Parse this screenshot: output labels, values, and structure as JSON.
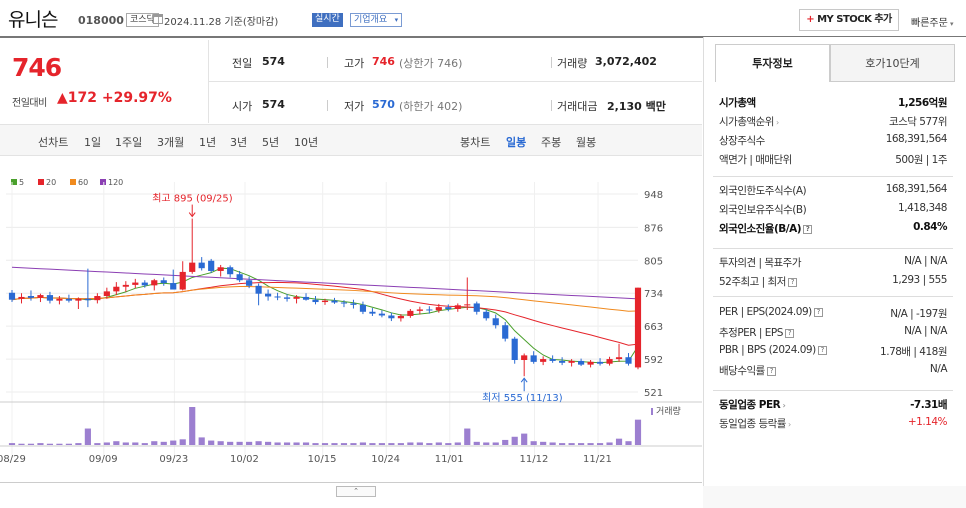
{
  "header": {
    "name": "유니슨",
    "code": "018000",
    "market": "코스닥",
    "date": "2024.11.28 기준(장마감)",
    "realtime": "실시간",
    "company_info": "기업개요",
    "mystock_plus": "+",
    "mystock": "MY STOCK 추가",
    "quick_order": "빠른주문"
  },
  "quote": {
    "price": "746",
    "change_label": "전일대비",
    "change": "172",
    "change_pct": "+29.97%",
    "prev_close_label": "전일",
    "prev_close": "574",
    "open_label": "시가",
    "open": "574",
    "high_label": "고가",
    "high": "746",
    "upper_limit": "(상한가 746)",
    "low_label": "저가",
    "low": "570",
    "lower_limit": "(하한가 402)",
    "volume_label": "거래량",
    "volume": "3,072,402",
    "amount_label": "거래대금",
    "amount": "2,130 백만"
  },
  "periods": {
    "line_label": "선차트",
    "line_items": [
      "1일",
      "1주일",
      "3개월",
      "1년",
      "3년",
      "5년",
      "10년"
    ],
    "candle_label": "봉차트",
    "candle_items": [
      "일봉",
      "주봉",
      "월봉"
    ],
    "candle_active": "일봉"
  },
  "legend": [
    "5",
    "20",
    "60",
    "120"
  ],
  "legend_colors": [
    "#4aa02c",
    "#e5242b",
    "#f08a1e",
    "#8b3fb3"
  ],
  "chart_data": {
    "type": "candlestick",
    "y_ticks": [
      "948",
      "876",
      "805",
      "734",
      "663",
      "592",
      "521"
    ],
    "ylim": [
      521,
      948
    ],
    "x_ticks": [
      "08/29",
      "09/09",
      "09/23",
      "10/02",
      "10/15",
      "10/24",
      "11/01",
      "11/12",
      "11/21"
    ],
    "annotations": {
      "high": "최고 895 (09/25)",
      "low": "최저 555 (11/13)"
    },
    "volume_label": "거래량",
    "up_color": "#e5242b",
    "down_color": "#2a6ad3",
    "candles": [
      {
        "o": 735,
        "h": 741,
        "l": 715,
        "c": 720
      },
      {
        "o": 722,
        "h": 734,
        "l": 712,
        "c": 726
      },
      {
        "o": 728,
        "h": 740,
        "l": 718,
        "c": 724
      },
      {
        "o": 724,
        "h": 733,
        "l": 715,
        "c": 730
      },
      {
        "o": 730,
        "h": 737,
        "l": 712,
        "c": 718
      },
      {
        "o": 718,
        "h": 728,
        "l": 710,
        "c": 722
      },
      {
        "o": 722,
        "h": 731,
        "l": 714,
        "c": 718
      },
      {
        "o": 718,
        "h": 725,
        "l": 700,
        "c": 722
      },
      {
        "o": 722,
        "h": 787,
        "l": 704,
        "c": 719
      },
      {
        "o": 719,
        "h": 734,
        "l": 712,
        "c": 728
      },
      {
        "o": 728,
        "h": 746,
        "l": 722,
        "c": 738
      },
      {
        "o": 738,
        "h": 758,
        "l": 730,
        "c": 748
      },
      {
        "o": 748,
        "h": 760,
        "l": 737,
        "c": 752
      },
      {
        "o": 752,
        "h": 765,
        "l": 745,
        "c": 757
      },
      {
        "o": 757,
        "h": 762,
        "l": 746,
        "c": 751
      },
      {
        "o": 751,
        "h": 765,
        "l": 740,
        "c": 762
      },
      {
        "o": 762,
        "h": 768,
        "l": 750,
        "c": 756
      },
      {
        "o": 756,
        "h": 785,
        "l": 742,
        "c": 742
      },
      {
        "o": 742,
        "h": 803,
        "l": 740,
        "c": 780
      },
      {
        "o": 780,
        "h": 895,
        "l": 776,
        "c": 800
      },
      {
        "o": 800,
        "h": 812,
        "l": 783,
        "c": 788
      },
      {
        "o": 804,
        "h": 808,
        "l": 778,
        "c": 782
      },
      {
        "o": 782,
        "h": 795,
        "l": 770,
        "c": 790
      },
      {
        "o": 790,
        "h": 794,
        "l": 768,
        "c": 775
      },
      {
        "o": 775,
        "h": 782,
        "l": 758,
        "c": 762
      },
      {
        "o": 762,
        "h": 770,
        "l": 745,
        "c": 750
      },
      {
        "o": 750,
        "h": 755,
        "l": 708,
        "c": 733
      },
      {
        "o": 733,
        "h": 742,
        "l": 718,
        "c": 727
      },
      {
        "o": 727,
        "h": 735,
        "l": 719,
        "c": 725
      },
      {
        "o": 725,
        "h": 732,
        "l": 716,
        "c": 722
      },
      {
        "o": 722,
        "h": 730,
        "l": 712,
        "c": 726
      },
      {
        "o": 726,
        "h": 734,
        "l": 718,
        "c": 720
      },
      {
        "o": 720,
        "h": 728,
        "l": 710,
        "c": 715
      },
      {
        "o": 715,
        "h": 722,
        "l": 709,
        "c": 718
      },
      {
        "o": 718,
        "h": 724,
        "l": 711,
        "c": 714
      },
      {
        "o": 714,
        "h": 719,
        "l": 704,
        "c": 712
      },
      {
        "o": 712,
        "h": 720,
        "l": 701,
        "c": 709
      },
      {
        "o": 709,
        "h": 716,
        "l": 689,
        "c": 694
      },
      {
        "o": 694,
        "h": 702,
        "l": 685,
        "c": 690
      },
      {
        "o": 690,
        "h": 697,
        "l": 682,
        "c": 686
      },
      {
        "o": 686,
        "h": 692,
        "l": 674,
        "c": 680
      },
      {
        "o": 680,
        "h": 689,
        "l": 673,
        "c": 685
      },
      {
        "o": 685,
        "h": 700,
        "l": 681,
        "c": 696
      },
      {
        "o": 696,
        "h": 705,
        "l": 688,
        "c": 699
      },
      {
        "o": 699,
        "h": 706,
        "l": 690,
        "c": 697
      },
      {
        "o": 697,
        "h": 711,
        "l": 692,
        "c": 704
      },
      {
        "o": 704,
        "h": 710,
        "l": 695,
        "c": 700
      },
      {
        "o": 700,
        "h": 712,
        "l": 694,
        "c": 708
      },
      {
        "o": 708,
        "h": 768,
        "l": 698,
        "c": 710
      },
      {
        "o": 712,
        "h": 716,
        "l": 688,
        "c": 694
      },
      {
        "o": 694,
        "h": 700,
        "l": 675,
        "c": 680
      },
      {
        "o": 680,
        "h": 688,
        "l": 658,
        "c": 665
      },
      {
        "o": 665,
        "h": 672,
        "l": 630,
        "c": 636
      },
      {
        "o": 636,
        "h": 640,
        "l": 582,
        "c": 590
      },
      {
        "o": 590,
        "h": 604,
        "l": 555,
        "c": 600
      },
      {
        "o": 600,
        "h": 609,
        "l": 582,
        "c": 586
      },
      {
        "o": 586,
        "h": 598,
        "l": 579,
        "c": 592
      },
      {
        "o": 592,
        "h": 600,
        "l": 584,
        "c": 588
      },
      {
        "o": 588,
        "h": 596,
        "l": 579,
        "c": 584
      },
      {
        "o": 584,
        "h": 592,
        "l": 576,
        "c": 588
      },
      {
        "o": 588,
        "h": 593,
        "l": 577,
        "c": 580
      },
      {
        "o": 580,
        "h": 590,
        "l": 574,
        "c": 586
      },
      {
        "o": 586,
        "h": 594,
        "l": 578,
        "c": 582
      },
      {
        "o": 582,
        "h": 597,
        "l": 578,
        "c": 592
      },
      {
        "o": 592,
        "h": 625,
        "l": 586,
        "c": 596
      },
      {
        "o": 596,
        "h": 605,
        "l": 578,
        "c": 582
      },
      {
        "o": 574,
        "h": 746,
        "l": 570,
        "c": 746
      }
    ],
    "volume": [
      3,
      2,
      2,
      3,
      2,
      2,
      2,
      3,
      26,
      3,
      4,
      6,
      4,
      4,
      3,
      6,
      5,
      7,
      9,
      60,
      12,
      7,
      6,
      5,
      5,
      5,
      6,
      5,
      4,
      4,
      4,
      4,
      3,
      3,
      3,
      3,
      3,
      4,
      3,
      3,
      3,
      3,
      4,
      4,
      3,
      4,
      3,
      4,
      26,
      5,
      4,
      4,
      8,
      13,
      18,
      6,
      5,
      4,
      3,
      3,
      3,
      3,
      3,
      4,
      10,
      6,
      40
    ]
  },
  "invest": {
    "tabs": [
      "투자정보",
      "호가10단계"
    ],
    "rows1": [
      {
        "label": "시가총액",
        "value": "1,256억원",
        "bold": true
      },
      {
        "label": "시가총액순위",
        "value": "코스닥 577위",
        "arrow": true
      },
      {
        "label": "상장주식수",
        "value": "168,391,564"
      },
      {
        "label": "액면가 | 매매단위",
        "value": "500원 | 1주"
      }
    ],
    "rows2": [
      {
        "label": "외국인한도주식수(A)",
        "value": "168,391,564"
      },
      {
        "label": "외국인보유주식수(B)",
        "value": "1,418,348"
      },
      {
        "label": "외국인소진율(B/A)",
        "value": "0.84%",
        "bold": true,
        "q": true
      }
    ],
    "rows3": [
      {
        "label": "투자의견 | 목표주가",
        "value": "N/A | N/A"
      },
      {
        "label": "52주최고 | 최저",
        "value": "1,293 | 555",
        "q": true
      }
    ],
    "rows4": [
      {
        "label": "PER | EPS(2024.09)",
        "value": "N/A | -197원",
        "q": true
      },
      {
        "label": "추정PER | EPS",
        "value": "N/A | N/A",
        "q": true
      },
      {
        "label": "PBR | BPS (2024.09)",
        "value": "1.78배 | 418원",
        "q": true
      },
      {
        "label": "배당수익률",
        "value": "N/A",
        "q": true
      }
    ],
    "rows5": [
      {
        "label": "동일업종 PER",
        "value": "-7.31배",
        "bold": true,
        "arrow": true
      },
      {
        "label": "동일업종 등락률",
        "value": "+1.14%",
        "red": true,
        "arrow": true
      }
    ],
    "collapse": "⌃"
  }
}
